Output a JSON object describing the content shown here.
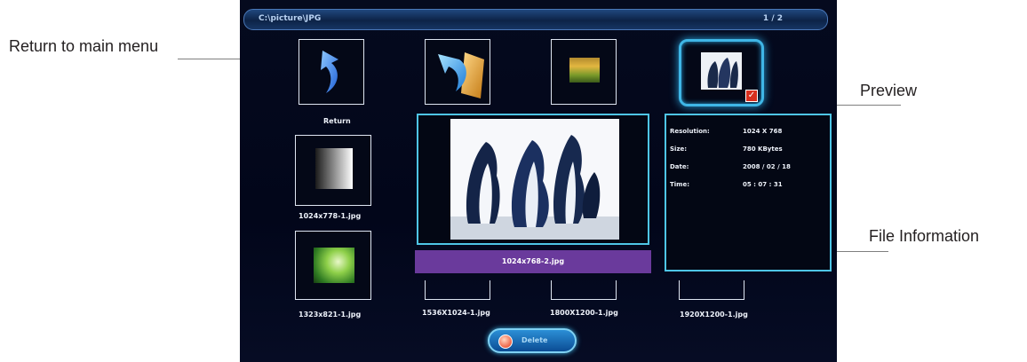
{
  "callouts": {
    "return_main_menu": "Return to main menu",
    "preview": "Preview",
    "file_information": "File Information"
  },
  "path_bar": {
    "path": "C:\\picture\\JPG",
    "page_indicator": "1 / 2"
  },
  "tiles": {
    "return_label": "Return",
    "file1": "1024x778-1.jpg",
    "file2": "1323x821-1.jpg",
    "file3": "1536X1024-1.jpg",
    "file4": "1800X1200-1.jpg",
    "file5": "1920X1200-1.jpg"
  },
  "selected_file": "1024x768-2.jpg",
  "info": {
    "resolution_label": "Resolution:",
    "resolution_value": "1024 X 768",
    "size_label": "Size:",
    "size_value": "780 KBytes",
    "date_label": "Date:",
    "date_value": "2008 / 02 / 18",
    "time_label": "Time:",
    "time_value": "05 : 07 : 31"
  },
  "delete_button_label": "Delete",
  "colors": {
    "accent": "#4ec5e6",
    "selection_bar": "#6a3a9c",
    "screen_bg": "#02061a"
  }
}
